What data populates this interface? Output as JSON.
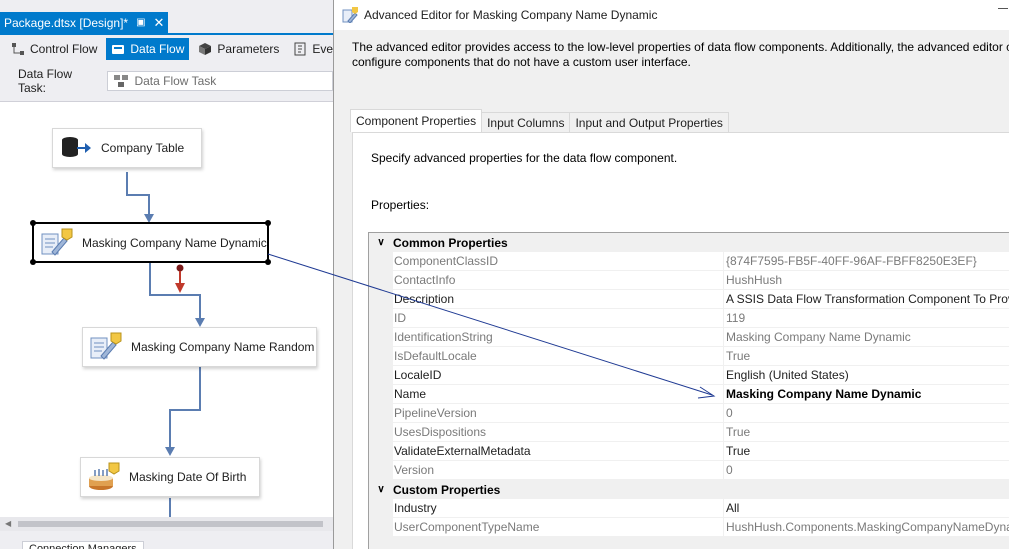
{
  "designer": {
    "doc_tab_title": "Package.dtsx [Design]*",
    "doc_tab_pin": "▣",
    "doc_tab_close": "✕",
    "tabs": [
      {
        "label": "Control Flow",
        "icon": "control-flow-icon",
        "active": false
      },
      {
        "label": "Data Flow",
        "icon": "data-flow-icon",
        "active": true
      },
      {
        "label": "Parameters",
        "icon": "parameters-icon",
        "active": false
      },
      {
        "label": "Event",
        "icon": "event-handlers-icon",
        "active": false
      }
    ],
    "task_label": "Data Flow Task:",
    "task_value": "Data Flow Task",
    "nodes": [
      {
        "label": "Company Table",
        "icon": "source-database-icon"
      },
      {
        "label": "Masking Company Name Dynamic",
        "icon": "script-component-icon"
      },
      {
        "label": "Masking Company Name Random",
        "icon": "script-component-icon"
      },
      {
        "label": "Masking Date Of Birth",
        "icon": "birthday-cake-icon"
      }
    ],
    "connection_tab": "Connection Managers"
  },
  "dialog": {
    "title": "Advanced Editor for Masking Company Name Dynamic",
    "intro_line1": "The advanced editor provides access to the low-level properties of data flow components. Additionally, the advanced editor c",
    "intro_line2": "configure components that do not have a custom user interface.",
    "tabs": [
      {
        "label": "Component Properties",
        "active": true
      },
      {
        "label": "Input Columns",
        "active": false
      },
      {
        "label": "Input and Output Properties",
        "active": false
      }
    ],
    "tab_description": "Specify advanced properties for the data flow component.",
    "properties_label": "Properties:",
    "categories": [
      {
        "name": "Common Properties",
        "rows": [
          {
            "name": "ComponentClassID",
            "value": "{874F7595-FB5F-40FF-96AF-FBFF8250E3EF}",
            "readonly": true
          },
          {
            "name": "ContactInfo",
            "value": "HushHush",
            "readonly": true
          },
          {
            "name": "Description",
            "value": "A SSIS Data Flow Transformation Component To Provide",
            "readonly": false
          },
          {
            "name": "ID",
            "value": "119",
            "readonly": true
          },
          {
            "name": "IdentificationString",
            "value": "Masking Company Name Dynamic",
            "readonly": true
          },
          {
            "name": "IsDefaultLocale",
            "value": "True",
            "readonly": true
          },
          {
            "name": "LocaleID",
            "value": "English (United States)",
            "readonly": false
          },
          {
            "name": "Name",
            "value": "Masking Company Name Dynamic",
            "readonly": false,
            "bold": true
          },
          {
            "name": "PipelineVersion",
            "value": "0",
            "readonly": true
          },
          {
            "name": "UsesDispositions",
            "value": "True",
            "readonly": true
          },
          {
            "name": "ValidateExternalMetadata",
            "value": "True",
            "readonly": false
          },
          {
            "name": "Version",
            "value": "0",
            "readonly": true
          }
        ]
      },
      {
        "name": "Custom Properties",
        "rows": [
          {
            "name": "Industry",
            "value": "All",
            "readonly": false
          },
          {
            "name": "UserComponentTypeName",
            "value": "HushHush.Components.MaskingCompanyNameDyna",
            "readonly": true
          }
        ]
      }
    ]
  },
  "colors": {
    "accent": "#007acc",
    "flow_arrow": "#5b7db1",
    "error_arrow": "#c0392b",
    "annotation_arrow": "#1f3a93"
  }
}
